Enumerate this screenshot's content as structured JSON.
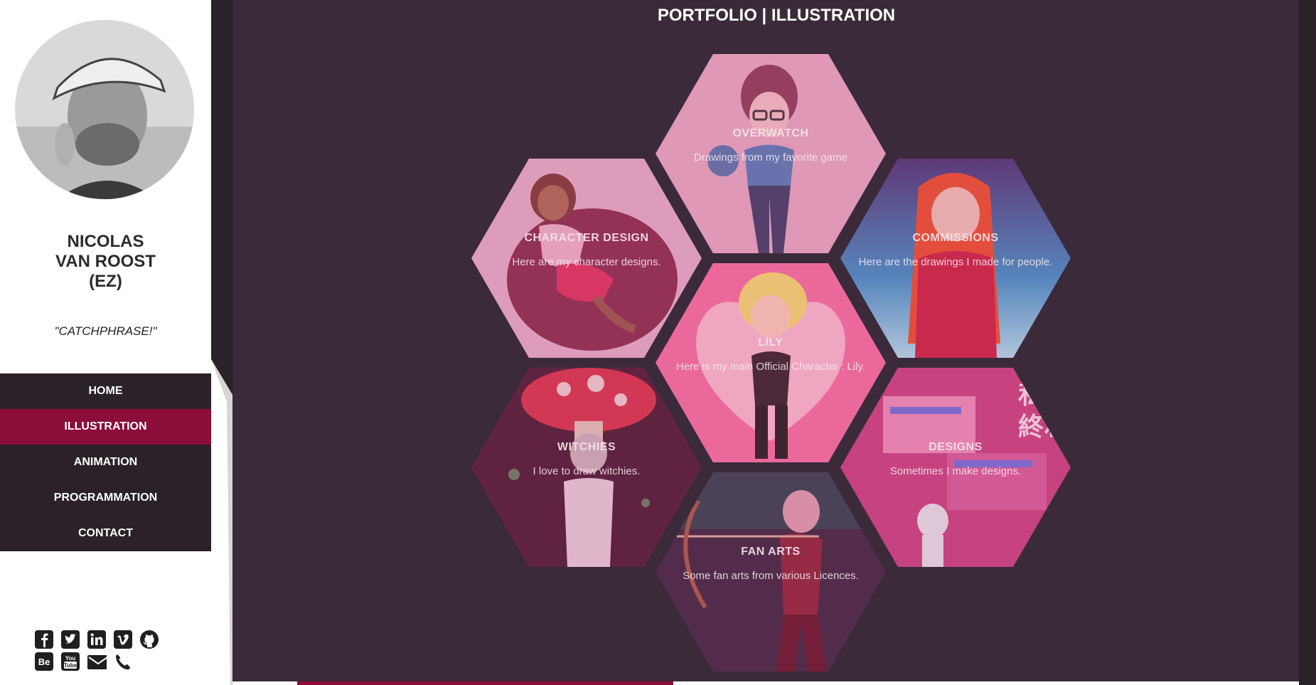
{
  "profile": {
    "name": "NICOLAS\nVAN ROOST\n(EZ)",
    "catchphrase": "\"CATCHPHRASE!\""
  },
  "nav": {
    "items": [
      {
        "label": "HOME"
      },
      {
        "label": "ILLUSTRATION"
      },
      {
        "label": "ANIMATION"
      },
      {
        "label": "PROGRAMMATION"
      },
      {
        "label": "CONTACT"
      }
    ],
    "active": "ILLUSTRATION"
  },
  "social": [
    "facebook-icon",
    "twitter-icon",
    "linkedin-icon",
    "vimeo-icon",
    "github-icon",
    "behance-icon",
    "youtube-icon",
    "email-icon",
    "phone-icon"
  ],
  "page": {
    "title": "PORTFOLIO | ILLUSTRATION"
  },
  "categories": [
    {
      "title": "OVERWATCH",
      "desc": "Drawings from my favorite game"
    },
    {
      "title": "CHARACTER DESIGN",
      "desc": "Here are my character designs."
    },
    {
      "title": "COMMISSIONS",
      "desc": "Here are the drawings I made for people."
    },
    {
      "title": "LILY",
      "desc": "Here is my main Official Character : Lily."
    },
    {
      "title": "WITCHIES",
      "desc": "I love to draw witchies."
    },
    {
      "title": "DESIGNS",
      "desc": "Sometimes I make designs."
    },
    {
      "title": "FAN ARTS",
      "desc": "Some fan arts from various Licences."
    }
  ],
  "colors": {
    "accent": "#8b0d3a",
    "sidebar_dark": "#2b2129",
    "main_bg": "#3b2a3a"
  }
}
